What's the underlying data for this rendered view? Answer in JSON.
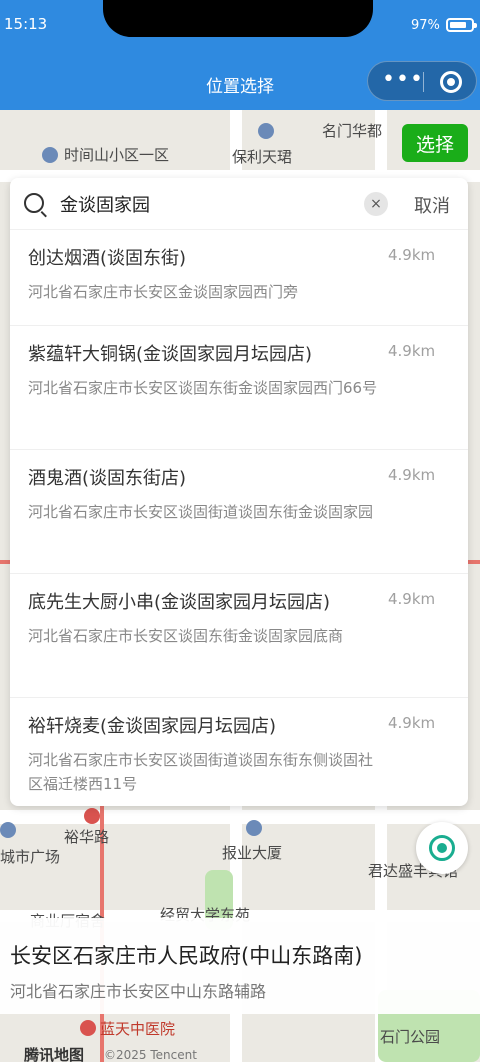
{
  "status": {
    "time": "15:13",
    "battery": "97%"
  },
  "nav": {
    "title": "位置选择"
  },
  "map": {
    "select_label": "选择",
    "labels": {
      "shijianshan": "时间山小区一区",
      "baoli": "保利天珺",
      "mingmen": "名门华都",
      "yuhua": "裕华路",
      "chengshi": "城市广场",
      "baoye": "报业大厦",
      "junda": "君达盛丰宾馆",
      "jingmao": "经贸大学东苑",
      "shangye": "商业厅宿舍",
      "lantian": "蓝天中医院",
      "shimen": "石门公园",
      "tencent": "腾讯地图",
      "copyright": "©2025 Tencent"
    }
  },
  "search": {
    "query": "金谈固家园",
    "clear_icon": "×",
    "cancel_label": "取消"
  },
  "results": [
    {
      "name": "创达烟酒(谈固东街)",
      "distance": "4.9km",
      "address": "河北省石家庄市长安区金谈固家园西门旁"
    },
    {
      "name": "紫蕴轩大铜锅(金谈固家园月坛园店)",
      "distance": "4.9km",
      "address": "河北省石家庄市长安区谈固东街金谈固家园西门66号"
    },
    {
      "name": "酒鬼酒(谈固东街店)",
      "distance": "4.9km",
      "address": "河北省石家庄市长安区谈固街道谈固东街金谈固家园"
    },
    {
      "name": "底先生大厨小串(金谈固家园月坛园店)",
      "distance": "4.9km",
      "address": "河北省石家庄市长安区谈固东街金谈固家园底商"
    },
    {
      "name": "裕轩烧麦(金谈固家园月坛园店)",
      "distance": "4.9km",
      "address": "河北省石家庄市长安区谈固街道谈固东街东侧谈固社区福迁楼西11号"
    }
  ],
  "selected": {
    "title": "长安区石家庄市人民政府(中山东路南)",
    "address": "河北省石家庄市长安区中山东路辅路"
  },
  "colors": {
    "nav_bg": "#2f8ae0",
    "select_green": "#1aad19",
    "locate_teal": "#1aad90"
  }
}
